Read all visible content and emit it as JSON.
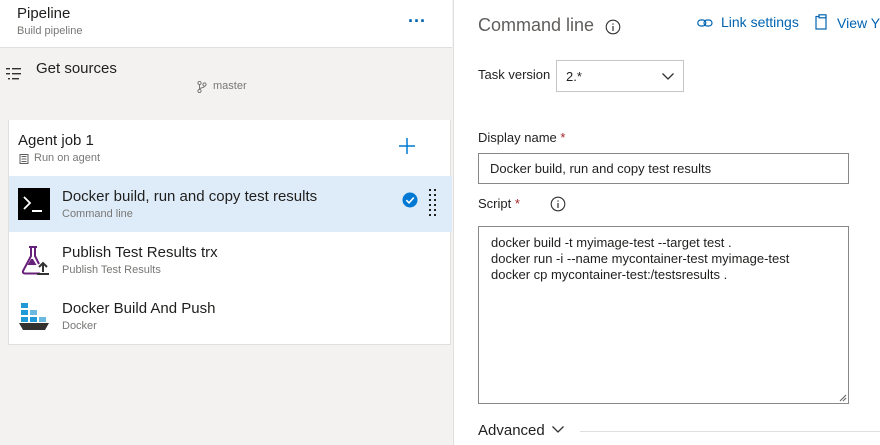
{
  "pipeline": {
    "title": "Pipeline",
    "subtitle": "Build pipeline",
    "more_label": "..."
  },
  "get_sources": {
    "label": "Get sources",
    "branch": "master"
  },
  "agent_job": {
    "title": "Agent job 1",
    "subtitle": "Run on agent"
  },
  "tasks": [
    {
      "title": "Docker build, run and copy test results",
      "subtitle": "Command line",
      "icon": "command-line-icon",
      "selected": true
    },
    {
      "title": "Publish Test Results trx",
      "subtitle": "Publish Test Results",
      "icon": "publish-test-results-icon",
      "selected": false
    },
    {
      "title": "Docker Build And Push",
      "subtitle": "Docker",
      "icon": "docker-icon",
      "selected": false
    }
  ],
  "detail": {
    "title": "Command line",
    "link_settings": "Link settings",
    "view_label": "View Y",
    "task_version_label": "Task version",
    "task_version_value": "2.*",
    "display_name_label": "Display name",
    "display_name_value": "Docker build, run and copy test results",
    "script_label": "Script",
    "required_mark": "*",
    "script_lines": [
      "docker build -t myimage-test --target test .",
      "docker run -i --name mycontainer-test myimage-test",
      "docker cp mycontainer-test:/testsresults ."
    ],
    "advanced_label": "Advanced"
  },
  "colors": {
    "accent": "#0063b1",
    "selected_bg": "#deecf9",
    "required": "#a4262c",
    "check": "#0078d4"
  }
}
